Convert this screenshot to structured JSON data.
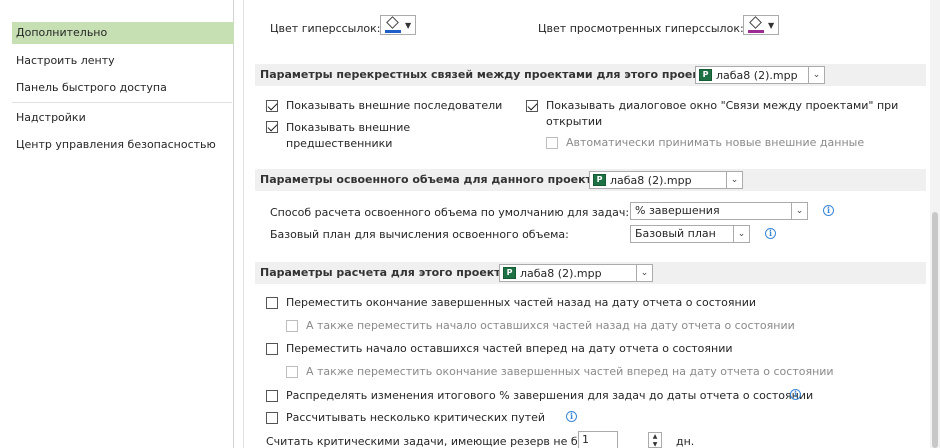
{
  "sidebar": {
    "items": [
      {
        "label": "Дополнительно"
      },
      {
        "label": "Настроить ленту"
      },
      {
        "label": "Панель быстрого доступа"
      },
      {
        "label": "Надстройки"
      },
      {
        "label": "Центр управления безопасностью"
      }
    ]
  },
  "colors": {
    "hyperlink_label": "Цвет гиперссылок:",
    "hyperlink_color": "#1f5fc9",
    "visited_label": "Цвет просмотренных гиперссылок:",
    "visited_color": "#9b2d93"
  },
  "cross_links": {
    "title": "Параметры перекрестных связей между проектами для этого проекта:",
    "file": "лаба8 (2).mpp",
    "show_successors": "Показывать внешние последователи",
    "show_predecessors_line1": "Показывать внешние",
    "show_predecessors_line2": "предшественники",
    "show_dialog_line1": "Показывать диалоговое окно \"Связи между проектами\" при",
    "show_dialog_line2": "открытии",
    "auto_accept": "Автоматически принимать новые внешние данные"
  },
  "earned_value": {
    "title": "Параметры освоенного объема для данного проекта:",
    "file": "лаба8 (2).mpp",
    "method_label": "Способ расчета освоенного объема по умолчанию для задач:",
    "method_value": "% завершения",
    "baseline_label": "Базовый план для вычисления освоенного объема:",
    "baseline_value": "Базовый план"
  },
  "calculation": {
    "title": "Параметры расчета для этого проекта:",
    "file": "лаба8 (2).mpp",
    "move_end_back": "Переместить окончание завершенных частей назад на дату отчета о состоянии",
    "move_start_back": "А также переместить начало оставшихся частей назад на дату отчета о состоянии",
    "move_start_forward": "Переместить начало оставшихся частей вперед на дату отчета о состоянии",
    "move_end_forward": "А также переместить окончание завершенных частей вперед на дату отчета о состоянии",
    "spread_percent": "Распределять изменения итогового % завершения для задач до даты отчета о состоянии",
    "multiple_critical": "Рассчитывать несколько критических путей",
    "critical_slack_label": "Считать критическими задачи, имеющие резерв не более",
    "critical_slack_value": "1",
    "critical_slack_unit": "дн."
  }
}
